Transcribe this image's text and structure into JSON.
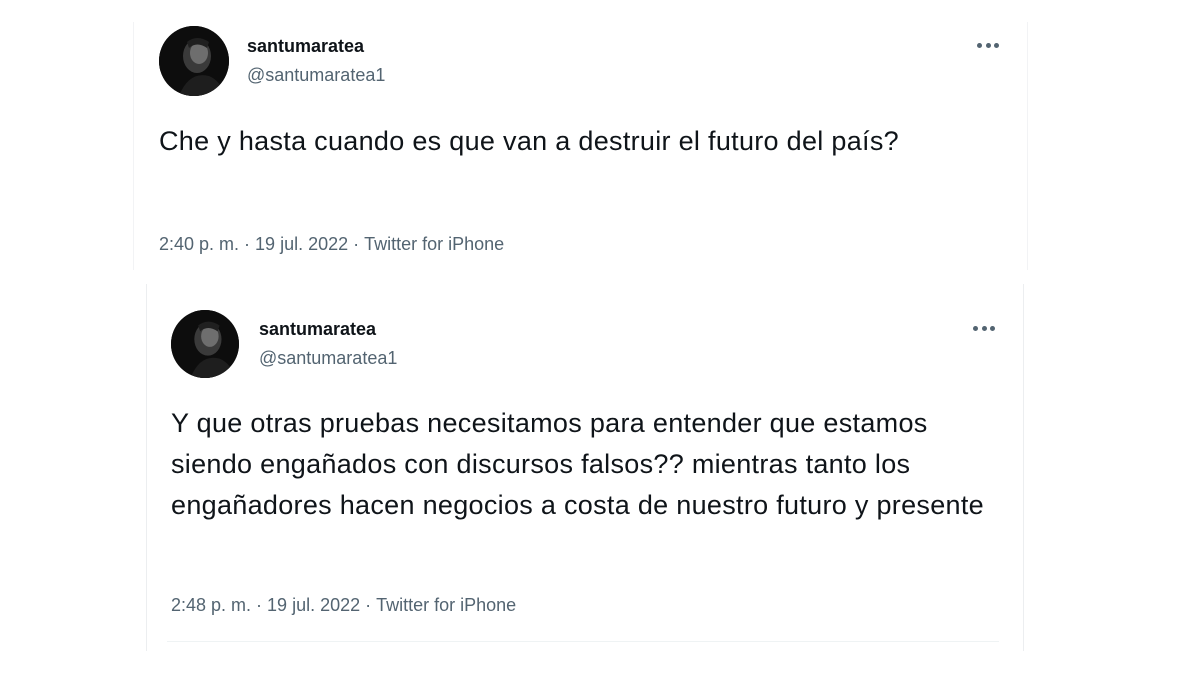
{
  "tweets": [
    {
      "display_name": "santumaratea",
      "handle": "@santumaratea1",
      "text": "Che y hasta cuando es que van a destruir el futuro del país?",
      "time": "2:40 p. m.",
      "date": "19 jul. 2022",
      "source": "Twitter for iPhone",
      "more_icon": "more-horizontal-icon"
    },
    {
      "display_name": "santumaratea",
      "handle": "@santumaratea1",
      "text": "Y que otras pruebas necesitamos para entender que estamos siendo engañados con discursos falsos?? mientras tanto los engañadores hacen negocios a costa de nuestro futuro y presente",
      "time": "2:48 p. m.",
      "date": "19 jul. 2022",
      "source": "Twitter for iPhone",
      "more_icon": "more-horizontal-icon"
    }
  ],
  "meta_separator": "·",
  "colors": {
    "text_primary": "#0f1419",
    "text_secondary": "#536471",
    "background": "#ffffff"
  }
}
